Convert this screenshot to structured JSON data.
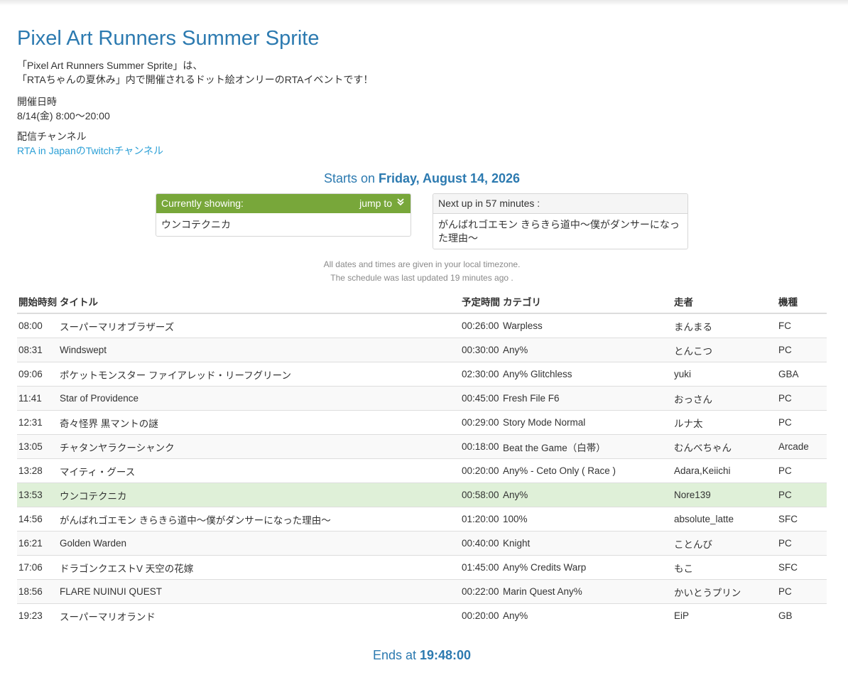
{
  "header": {
    "title": "Pixel Art Runners Summer Sprite",
    "desc_line1": "「Pixel Art Runners Summer Sprite」は、",
    "desc_line2": "「RTAちゃんの夏休み」内で開催されるドット絵オンリーのRTAイベントです！",
    "date_label": "開催日時",
    "date_value": "8/14(金) 8:00～20:00",
    "channel_label": "配信チャンネル",
    "channel_link": "RTA in JapanのTwitchチャンネル"
  },
  "starts": {
    "prefix": "Starts on ",
    "date": "Friday, August 14, 2026"
  },
  "current_panel": {
    "heading": "Currently showing:",
    "jump_label": "jump to",
    "jump_icon": "double-chevron-down-icon",
    "content": "ウンコテクニカ"
  },
  "next_panel": {
    "heading": "Next up in 57 minutes :",
    "content": "がんばれゴエモン きらきら道中～僕がダンサーになった理由～"
  },
  "notes": {
    "timezone": "All dates and times are given in your local timezone.",
    "updated": "The schedule was last updated 19 minutes ago ."
  },
  "table": {
    "headers": {
      "start": "開始時刻",
      "title": "タイトル",
      "estimate": "予定時間",
      "category": "カテゴリ",
      "runner": "走者",
      "platform": "機種"
    },
    "rows": [
      {
        "start": "08:00",
        "title": "スーパーマリオブラザーズ",
        "estimate": "00:26:00",
        "category": "Warpless",
        "runner": "まんまる",
        "platform": "FC"
      },
      {
        "start": "08:31",
        "title": "Windswept",
        "estimate": "00:30:00",
        "category": "Any%",
        "runner": "とんこつ",
        "platform": "PC"
      },
      {
        "start": "09:06",
        "title": "ポケットモンスター ファイアレッド・リーフグリーン",
        "estimate": "02:30:00",
        "category": "Any% Glitchless",
        "runner": "yuki",
        "platform": "GBA"
      },
      {
        "start": "11:41",
        "title": "Star of Providence",
        "estimate": "00:45:00",
        "category": "Fresh File F6",
        "runner": "おっさん",
        "platform": "PC"
      },
      {
        "start": "12:31",
        "title": "奇々怪界 黒マントの謎",
        "estimate": "00:29:00",
        "category": "Story Mode Normal",
        "runner": "ルナ太",
        "platform": "PC"
      },
      {
        "start": "13:05",
        "title": "チャタンヤラクーシャンク",
        "estimate": "00:18:00",
        "category": "Beat the Game（白帯）",
        "runner": "むんべちゃん",
        "platform": "Arcade"
      },
      {
        "start": "13:28",
        "title": "マイティ・グース",
        "estimate": "00:20:00",
        "category": "Any% - Ceto Only ( Race )",
        "runner": "Adara,Keiichi",
        "platform": "PC"
      },
      {
        "start": "13:53",
        "title": "ウンコテクニカ",
        "estimate": "00:58:00",
        "category": "Any%",
        "runner": "Nore139",
        "platform": "PC",
        "current": true
      },
      {
        "start": "14:56",
        "title": "がんばれゴエモン きらきら道中～僕がダンサーになった理由～",
        "estimate": "01:20:00",
        "category": "100%",
        "runner": "absolute_latte",
        "platform": "SFC"
      },
      {
        "start": "16:21",
        "title": "Golden Warden",
        "estimate": "00:40:00",
        "category": "Knight",
        "runner": "ことんび",
        "platform": "PC"
      },
      {
        "start": "17:06",
        "title": "ドラゴンクエストV 天空の花嫁",
        "estimate": "01:45:00",
        "category": "Any% Credits Warp",
        "runner": "もこ",
        "platform": "SFC"
      },
      {
        "start": "18:56",
        "title": "FLARE NUINUI QUEST",
        "estimate": "00:22:00",
        "category": "Marin Quest Any%",
        "runner": "かいとうプリン",
        "platform": "PC"
      },
      {
        "start": "19:23",
        "title": "スーパーマリオランド",
        "estimate": "00:20:00",
        "category": "Any%",
        "runner": "EiP",
        "platform": "GB"
      }
    ]
  },
  "ends": {
    "prefix": "Ends at ",
    "time": "19:48:00"
  },
  "colors": {
    "title": "#2c7ab0",
    "link": "#2a9fd6",
    "current_header": "#78a73a",
    "current_row": "#dff0d8"
  }
}
